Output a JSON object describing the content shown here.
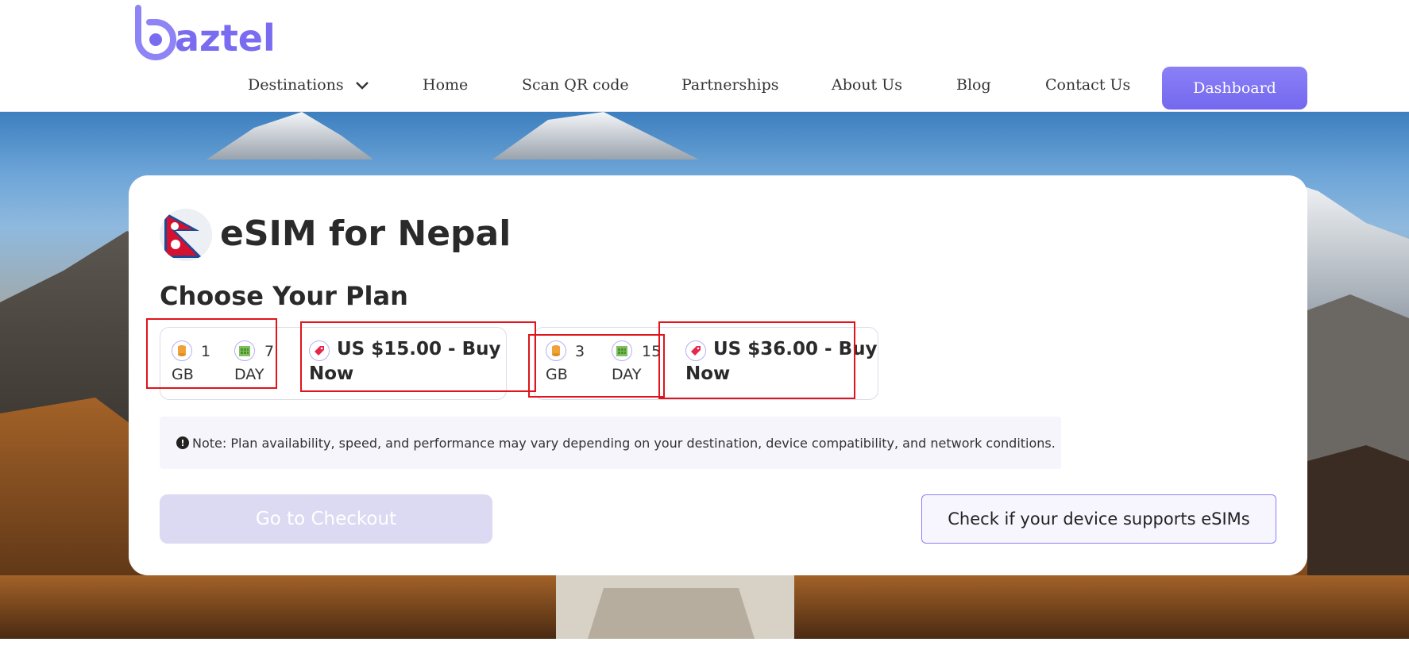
{
  "brand": {
    "name": "aztel",
    "accent": "#7a6cf0"
  },
  "nav": {
    "items": [
      {
        "label": "Destinations",
        "has_dropdown": true
      },
      {
        "label": "Home"
      },
      {
        "label": "Scan QR code"
      },
      {
        "label": "Partnerships"
      },
      {
        "label": "About Us"
      },
      {
        "label": "Blog"
      },
      {
        "label": "Contact Us"
      }
    ],
    "dashboard_label": "Dashboard"
  },
  "page": {
    "title": "eSIM for Nepal",
    "subtitle": "Choose Your Plan",
    "flag_icon": "nepal-flag-icon"
  },
  "plans": [
    {
      "data_value": "1",
      "data_unit": "GB",
      "days_value": "7",
      "days_unit": "DAY",
      "price_label": "US $15.00 - Buy",
      "price_label_2": "Now"
    },
    {
      "data_value": "3",
      "data_unit": "GB",
      "days_value": "15",
      "days_unit": "DAY",
      "price_label": "US $36.00 - Buy",
      "price_label_2": "Now"
    }
  ],
  "note": {
    "icon": "exclamation-circle-icon",
    "text": "Note: Plan availability, speed, and performance may vary depending on your destination, device compatibility, and network conditions."
  },
  "actions": {
    "checkout_label": "Go to Checkout",
    "check_device_label": "Check if your device supports eSIMs"
  },
  "colors": {
    "primary": "#7a6cf0",
    "checkout_disabled": "#dcd9f3",
    "highlight": "#e0141b"
  }
}
